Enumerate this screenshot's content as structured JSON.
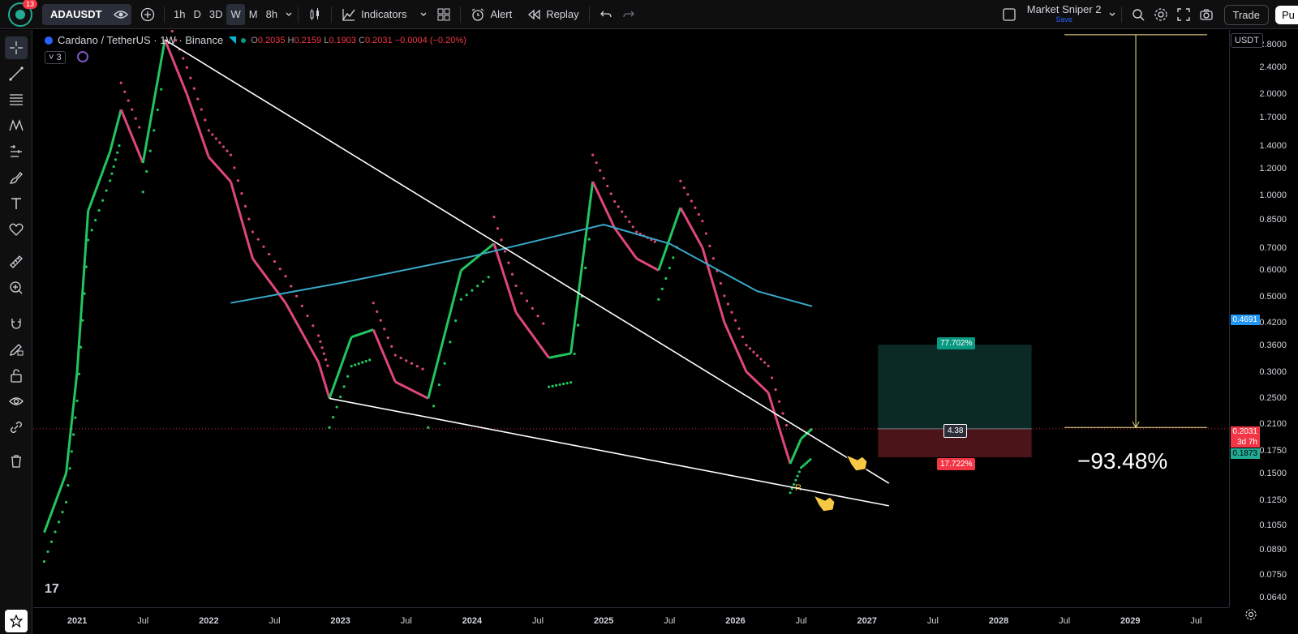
{
  "topbar": {
    "notification_count": "13",
    "symbol": "ADAUSDT",
    "intervals": [
      "1h",
      "D",
      "3D",
      "W",
      "M",
      "8h"
    ],
    "active_interval": "W",
    "indicators_label": "Indicators",
    "alert_label": "Alert",
    "replay_label": "Replay",
    "layout_name": "Market Sniper 2",
    "layout_status": "Save",
    "trade_label": "Trade",
    "publish_label": "Pu"
  },
  "legend": {
    "title": "Cardano / TetherUS · 1W · Binance",
    "open": "0.2035",
    "high": "0.2159",
    "low": "0.1903",
    "close": "0.2031",
    "change": "−0.0004 (−0.20%)",
    "indicator_count": "3"
  },
  "price_axis": {
    "currency": "USDT",
    "ticks": [
      "2.8000",
      "2.4000",
      "2.0000",
      "1.7000",
      "1.4000",
      "1.2000",
      "1.0000",
      "0.8500",
      "0.7000",
      "0.6000",
      "0.5000",
      "0.4200",
      "0.3600",
      "0.3000",
      "0.2500",
      "0.2100",
      "0.1750",
      "0.1500",
      "0.1250",
      "0.1050",
      "0.0890",
      "0.0750",
      "0.0640"
    ],
    "ma_label": "0.4691",
    "current_price": "0.2031",
    "countdown": "3d 7h",
    "stop_label": "0.1873"
  },
  "time_axis": {
    "ticks": [
      "2021",
      "Jul",
      "2022",
      "Jul",
      "2023",
      "Jul",
      "2024",
      "Jul",
      "2025",
      "Jul",
      "2026",
      "Jul",
      "2027",
      "Jul",
      "2028",
      "Jul",
      "2029",
      "Jul"
    ]
  },
  "annotations": {
    "target_pct": "77.702%",
    "risk_reward": "4.38",
    "stop_pct": "17.722%",
    "drawdown": "−93.48%",
    "r_marker": "R"
  },
  "chart_data": {
    "type": "line",
    "title": "Cardano / TetherUS · 1W · Binance",
    "y_scale": "log",
    "ylim": [
      0.06,
      3.1
    ],
    "xlim": [
      "2020-09",
      "2029-10"
    ],
    "series": [
      {
        "values": [
          {
            "x": "2020-10",
            "y": 0.1
          },
          {
            "x": "2020-12",
            "y": 0.15
          },
          {
            "x": "2021-01",
            "y": 0.3
          },
          {
            "x": "2021-02",
            "y": 0.9
          },
          {
            "x": "2021-04",
            "y": 1.35
          },
          {
            "x": "2021-05",
            "y": 1.8
          },
          {
            "x": "2021-07",
            "y": 1.25
          },
          {
            "x": "2021-09",
            "y": 2.9
          },
          {
            "x": "2021-11",
            "y": 2.0
          },
          {
            "x": "2022-01",
            "y": 1.3
          },
          {
            "x": "2022-03",
            "y": 1.1
          },
          {
            "x": "2022-05",
            "y": 0.65
          },
          {
            "x": "2022-08",
            "y": 0.48
          },
          {
            "x": "2022-11",
            "y": 0.32
          },
          {
            "x": "2022-12",
            "y": 0.25
          },
          {
            "x": "2023-02",
            "y": 0.38
          },
          {
            "x": "2023-04",
            "y": 0.4
          },
          {
            "x": "2023-06",
            "y": 0.28
          },
          {
            "x": "2023-09",
            "y": 0.25
          },
          {
            "x": "2023-12",
            "y": 0.6
          },
          {
            "x": "2024-03",
            "y": 0.72
          },
          {
            "x": "2024-05",
            "y": 0.45
          },
          {
            "x": "2024-08",
            "y": 0.33
          },
          {
            "x": "2024-10",
            "y": 0.34
          },
          {
            "x": "2024-12",
            "y": 1.1
          },
          {
            "x": "2025-02",
            "y": 0.8
          },
          {
            "x": "2025-04",
            "y": 0.65
          },
          {
            "x": "2025-06",
            "y": 0.6
          },
          {
            "x": "2025-08",
            "y": 0.92
          },
          {
            "x": "2025-10",
            "y": 0.7
          },
          {
            "x": "2025-12",
            "y": 0.42
          },
          {
            "x": "2026-02",
            "y": 0.3
          },
          {
            "x": "2026-04",
            "y": 0.26
          },
          {
            "x": "2026-06",
            "y": 0.16
          },
          {
            "x": "2026-07",
            "y": 0.19
          },
          {
            "x": "2026-08",
            "y": 0.2031
          }
        ]
      },
      {
        "values": [
          {
            "x": "2022-03",
            "y": 0.48
          },
          {
            "x": "2023-01",
            "y": 0.55
          },
          {
            "x": "2024-01",
            "y": 0.66
          },
          {
            "x": "2025-01",
            "y": 0.82
          },
          {
            "x": "2025-07",
            "y": 0.72
          },
          {
            "x": "2026-03",
            "y": 0.52
          },
          {
            "x": "2026-08",
            "y": 0.4691
          }
        ]
      }
    ],
    "trendlines": [
      {
        "from": {
          "x": "2021-09",
          "y": 2.9
        },
        "to": {
          "x": "2027-03",
          "y": 0.14
        }
      },
      {
        "from": {
          "x": "2022-12",
          "y": 0.25
        },
        "to": {
          "x": "2027-03",
          "y": 0.12
        }
      }
    ],
    "position": {
      "entry": 0.2031,
      "target": 0.3609,
      "stop": 0.1671,
      "target_pct": "77.702%",
      "stop_pct": "17.722%",
      "ratio": "4.38"
    },
    "measure": {
      "from": 3.0,
      "to": 0.205,
      "change": "−93.48%"
    }
  }
}
